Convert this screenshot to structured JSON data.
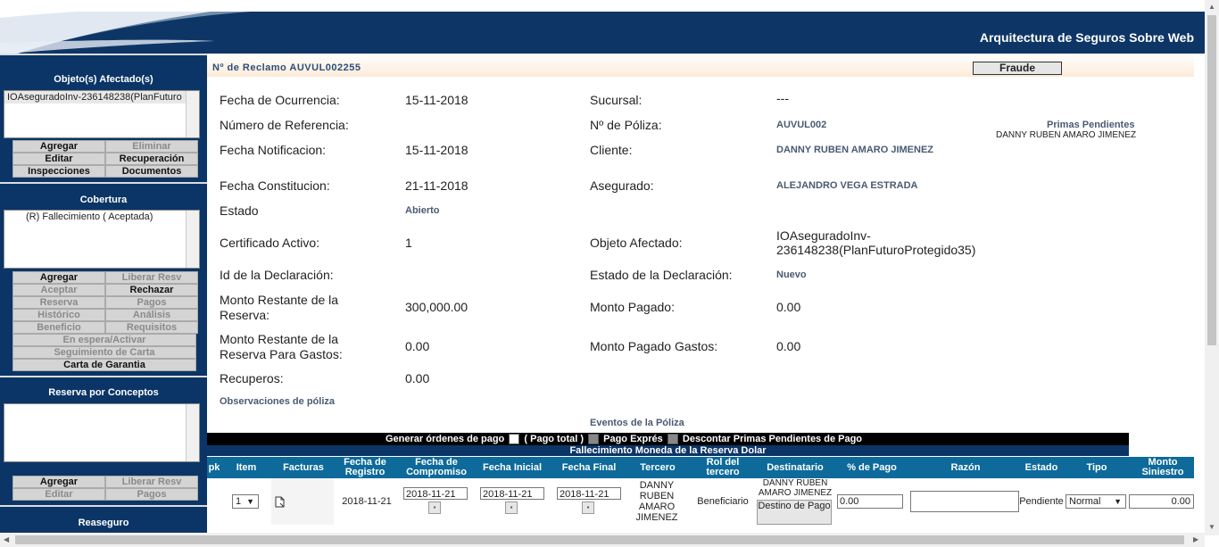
{
  "header": {
    "app_title": "Arquitectura de Seguros Sobre Web"
  },
  "left_panel": {
    "objects": {
      "title": "Objeto(s) Afectado(s)",
      "items": [
        "IOAseguradoInv-236148238(PlanFuturo"
      ],
      "buttons": {
        "agregar": "Agregar",
        "eliminar": "Eliminar",
        "editar": "Editar",
        "recuperacion": "Recuperación",
        "inspecciones": "Inspecciones",
        "documentos": "Documentos"
      }
    },
    "coverage": {
      "title": "Cobertura",
      "items": [
        "(R) Fallecimiento ( Aceptada)"
      ],
      "buttons": {
        "agregar": "Agregar",
        "liberar_resv": "Liberar Resv",
        "aceptar": "Aceptar",
        "rechazar": "Rechazar",
        "reserva": "Reserva",
        "pagos": "Pagos",
        "historico": "Histórico",
        "analisis": "Análisis",
        "beneficio": "Beneficio",
        "requisitos": "Requisitos",
        "en_espera": "En espera/Activar",
        "seguimiento": "Seguimiento de Carta",
        "carta_garantia": "Carta de Garantia"
      }
    },
    "reserve_concepts": {
      "title": "Reserva por Conceptos",
      "buttons": {
        "agregar": "Agregar",
        "liberar_resv": "Liberar Resv",
        "editar": "Editar",
        "pagos": "Pagos"
      }
    },
    "reinsurance": {
      "title": "Reaseguro"
    }
  },
  "claim": {
    "number_label": "Nº de Reclamo AUVUL002255",
    "fraud_button": "Fraude",
    "fields": {
      "fecha_ocurrencia_label": "Fecha de Ocurrencia:",
      "fecha_ocurrencia": "15-11-2018",
      "sucursal_label": "Sucursal:",
      "sucursal": "---",
      "num_referencia_label": "Número de Referencia:",
      "poliza_label": "Nº de Póliza:",
      "poliza": "AUVUL002",
      "primas_pendientes_label": "Primas Pendientes",
      "primas_pendientes_name": "DANNY RUBEN AMARO JIMENEZ",
      "fecha_notificacion_label": "Fecha Notificacion:",
      "fecha_notificacion": "15-11-2018",
      "cliente_label": "Cliente:",
      "cliente": "DANNY RUBEN AMARO JIMENEZ",
      "fecha_constitucion_label": "Fecha Constitucion:",
      "fecha_constitucion": "21-11-2018",
      "asegurado_label": "Asegurado:",
      "asegurado": "ALEJANDRO VEGA ESTRADA",
      "estado_label": "Estado",
      "estado": "Abierto",
      "certificado_label": "Certificado Activo:",
      "certificado": "1",
      "objeto_afectado_label": "Objeto Afectado:",
      "objeto_afectado_1": "IOAseguradoInv-",
      "objeto_afectado_2": "236148238(PlanFuturoProtegido35)",
      "id_declaracion_label": "Id de la Declaración:",
      "estado_declaracion_label": "Estado de la Declaración:",
      "estado_declaracion": "Nuevo",
      "monto_restante_label_1": "Monto Restante de la",
      "monto_restante_label_2": "Reserva:",
      "monto_restante": "300,000.00",
      "monto_pagado_label": "Monto Pagado:",
      "monto_pagado": "0.00",
      "monto_gastos_label_1": "Monto Restante de la",
      "monto_gastos_label_2": "Reserva Para Gastos:",
      "monto_gastos": "0.00",
      "monto_pagado_gastos_label": "Monto Pagado Gastos:",
      "monto_pagado_gastos": "0.00",
      "recuperos_label": "Recuperos:",
      "recuperos": "0.00",
      "observaciones_label": "Observaciones de póliza",
      "eventos_label": "Eventos de la Póliza"
    }
  },
  "payment_bar": {
    "generar": "Generar órdenes de pago",
    "pago_total": "( Pago total )",
    "pago_expres": "Pago Exprés",
    "descontar": "Descontar Primas Pendientes de Pago",
    "reserva_title": "Fallecimiento Moneda de la Reserva Dolar"
  },
  "table": {
    "headers": [
      "pk",
      "Item",
      "Facturas",
      "Fecha de Registro",
      "Fecha de Compromiso",
      "Fecha Inicial",
      "Fecha Final",
      "Tercero",
      "Rol del tercero",
      "Destinatario",
      "% de Pago",
      "Razón",
      "Estado",
      "Tipo",
      "Monto Siniestro"
    ],
    "row": {
      "item": "1",
      "fecha_registro": "2018-11-21",
      "fecha_compromiso": "2018-11-21",
      "fecha_inicial": "2018-11-21",
      "fecha_final": "2018-11-21",
      "tercero": "DANNY RUBEN AMARO JIMENEZ",
      "rol": "Beneficiario",
      "destinatario": "DANNY RUBEN AMARO JIMENEZ",
      "destino_btn": "Destino de Pago",
      "pct_pago": "0.00",
      "estado": "Pendiente",
      "tipo": "Normal",
      "monto": "0.00"
    }
  }
}
